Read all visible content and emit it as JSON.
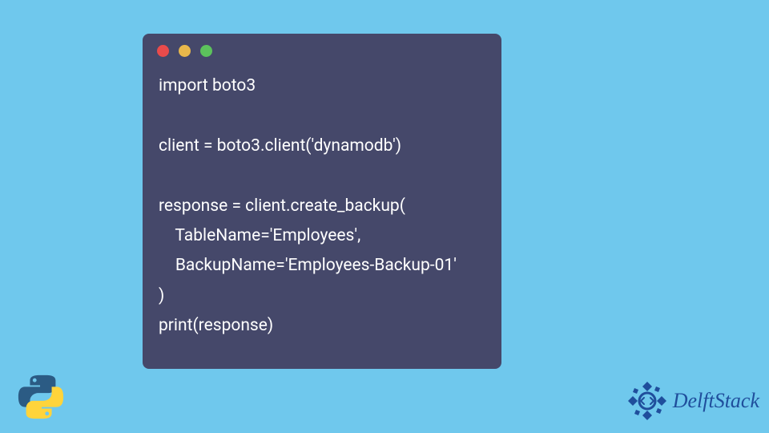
{
  "code": {
    "lines": [
      "import boto3",
      "",
      "client = boto3.client('dynamodb')",
      "",
      "response = client.create_backup(",
      "    TableName='Employees',",
      "    BackupName='Employees-Backup-01'",
      ")",
      "print(response)"
    ]
  },
  "brand": {
    "name": "DelftStack"
  },
  "colors": {
    "background": "#6fc8ed",
    "window": "#45486a",
    "text": "#ffffff",
    "brand": "#1f4e9c"
  }
}
